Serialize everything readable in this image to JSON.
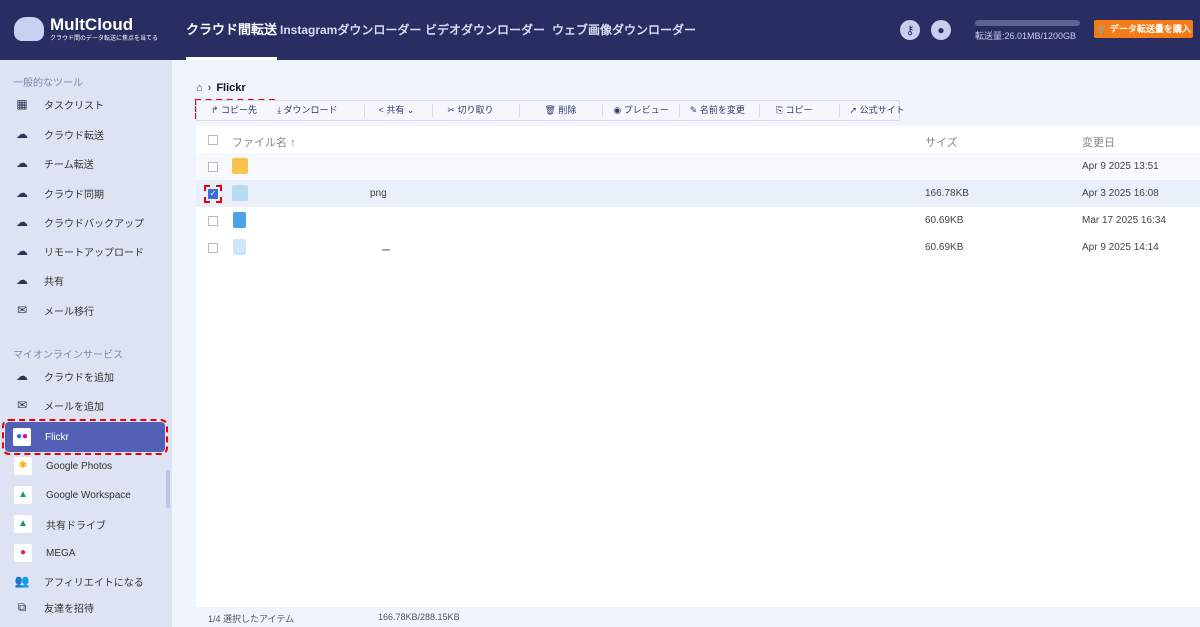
{
  "header": {
    "brand": "MultCloud",
    "tagline": "クラウド間のデータ転送に焦点を当てる",
    "nav": [
      "クラウド間転送",
      "Instagramダウンローダー",
      "ビデオダウンローダー",
      "ウェブ画像ダウンローダー"
    ],
    "quota": "転送量:26.01MB/1200GB",
    "quota_used_fraction": 2e-05,
    "buy": "データ転送量を購入"
  },
  "sidebar": {
    "section1": "一般的なツール",
    "tools": [
      "タスクリスト",
      "クラウド転送",
      "チーム転送",
      "クラウド同期",
      "クラウドバックアップ",
      "リモートアップロード",
      "共有",
      "メール移行"
    ],
    "section2": "マイオンラインサービス",
    "services": [
      "クラウドを追加",
      "メールを追加",
      "Flickr",
      "Google Photos",
      "Google Workspace",
      "共有ドライブ",
      "MEGA",
      "アフィリエイトになる",
      "友達を招待"
    ]
  },
  "breadcrumb": {
    "current": "Flickr"
  },
  "toolbar": [
    "コピー先",
    "ダウンロード",
    "共有",
    "切り取り",
    "削除",
    "プレビュー",
    "名前を変更",
    "コピー",
    "公式サイト"
  ],
  "table": {
    "headers": {
      "name": "ファイル名",
      "size": "サイズ",
      "modified": "変更日"
    },
    "rows": [
      {
        "name": "",
        "size": "",
        "modified": "Apr 9 2025 13:51"
      },
      {
        "name": "png",
        "size": "166.78KB",
        "modified": "Apr 3 2025 16:08"
      },
      {
        "name": "",
        "size": "60.69KB",
        "modified": "Mar 17 2025 16:34"
      },
      {
        "name": "ー",
        "size": "60.69KB",
        "modified": "Apr 9 2025 14:14"
      }
    ]
  },
  "status": {
    "selected": "1/4 選択したアイテム",
    "size": "166.78KB/288.15KB"
  }
}
